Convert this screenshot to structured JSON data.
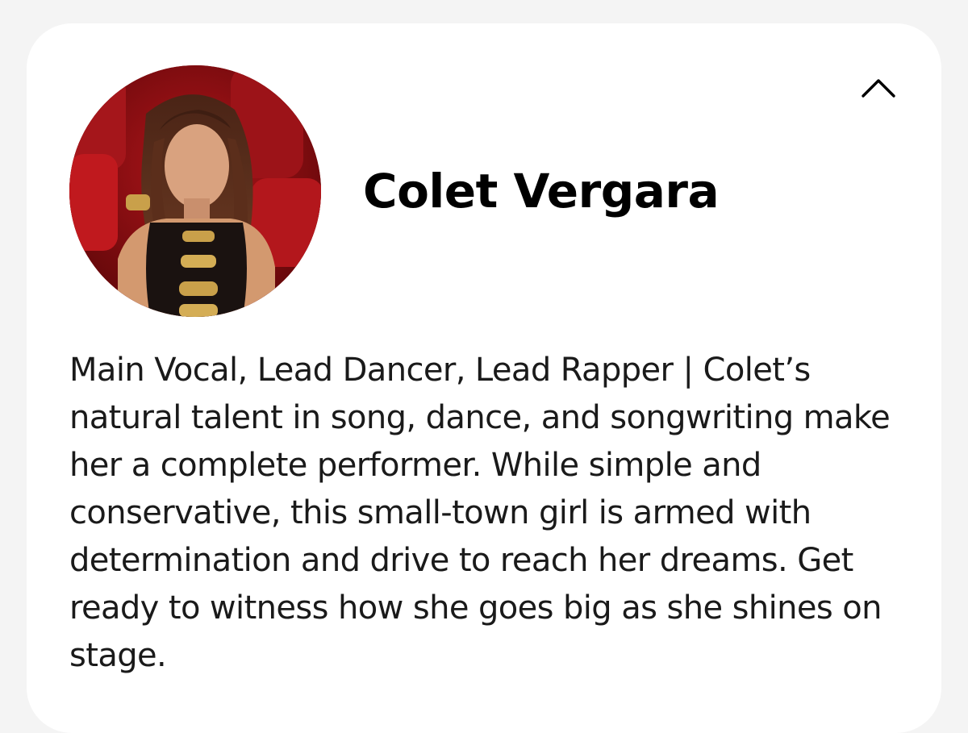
{
  "profile": {
    "name": "Colet Vergara",
    "avatar_alt": "Colet Vergara portrait",
    "bio": "Main Vocal, Lead Dancer, Lead Rapper | Colet’s natural talent in song, dance, and songwriting make her a complete performer. While simple and conservative, this small-town girl is armed with determination and drive to reach her dreams. Get ready to witness how she goes big as she shines on stage."
  },
  "controls": {
    "collapse_icon": "chevron-up-icon"
  },
  "colors": {
    "card_background": "#ffffff",
    "page_background": "#f4f4f4",
    "text": "#000000"
  }
}
